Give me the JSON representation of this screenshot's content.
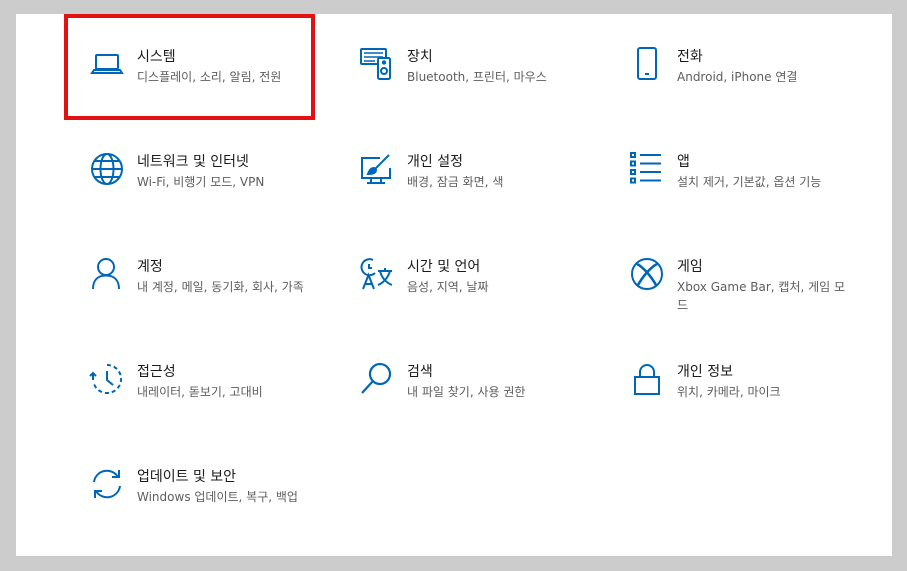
{
  "accent": "#0067b8",
  "highlight_color": "#e31212",
  "tiles": [
    {
      "title": "시스템",
      "desc": "디스플레이, 소리, 알림, 전원",
      "icon": "laptop-icon"
    },
    {
      "title": "장치",
      "desc": "Bluetooth, 프린터, 마우스",
      "icon": "devices-icon"
    },
    {
      "title": "전화",
      "desc": "Android, iPhone 연결",
      "icon": "phone-icon"
    },
    {
      "title": "네트워크 및 인터넷",
      "desc": "Wi-Fi, 비행기 모드, VPN",
      "icon": "globe-icon"
    },
    {
      "title": "개인 설정",
      "desc": "배경, 잠금 화면, 색",
      "icon": "personalization-icon"
    },
    {
      "title": "앱",
      "desc": "설치 제거, 기본값, 옵션 기능",
      "icon": "apps-list-icon"
    },
    {
      "title": "계정",
      "desc": "내 계정, 메일, 동기화, 회사, 가족",
      "icon": "person-icon"
    },
    {
      "title": "시간 및 언어",
      "desc": "음성, 지역, 날짜",
      "icon": "time-language-icon"
    },
    {
      "title": "게임",
      "desc": "Xbox Game Bar, 캡처, 게임 모드",
      "icon": "xbox-icon"
    },
    {
      "title": "접근성",
      "desc": "내레이터, 돋보기, 고대비",
      "icon": "accessibility-icon"
    },
    {
      "title": "검색",
      "desc": "내 파일 찾기, 사용 권한",
      "icon": "search-icon"
    },
    {
      "title": "개인 정보",
      "desc": "위치, 카메라, 마이크",
      "icon": "lock-icon"
    },
    {
      "title": "업데이트 및 보안",
      "desc": "Windows 업데이트, 복구, 백업",
      "icon": "update-icon"
    }
  ]
}
